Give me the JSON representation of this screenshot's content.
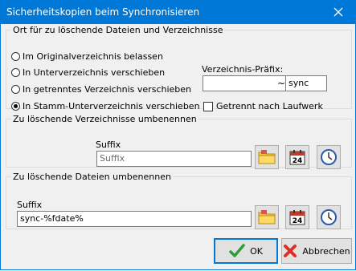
{
  "window": {
    "title": "Sicherheitskopien beim Synchronisieren"
  },
  "group_location": {
    "legend": "Ort für zu löschende Dateien und Verzeichnisse",
    "options": [
      {
        "label": "Im Originalverzeichnis belassen",
        "checked": false
      },
      {
        "label": "In Unterverzeichnis verschieben",
        "checked": false
      },
      {
        "label": "In getrenntes Verzeichnis verschieben",
        "checked": false
      },
      {
        "label": "In Stamm-Unterverzeichnis verschieben",
        "checked": true
      }
    ],
    "prefix_label": "Verzeichnis-Präfix:",
    "prefix_value": "",
    "prefix_separator": "~",
    "prefix_suffix_value": "sync",
    "separate_drive_label": "Getrennt nach Laufwerk",
    "separate_drive_checked": false
  },
  "group_dirs": {
    "legend": "Zu löschende Verzeichnisse umbenennen",
    "suffix_label": "Suffix",
    "suffix_placeholder": "Suffix",
    "suffix_value": ""
  },
  "group_files": {
    "legend": "Zu löschende Dateien umbenennen",
    "suffix_label": "Suffix",
    "suffix_value": "sync-%fdate%"
  },
  "calendar_day": "24",
  "buttons": {
    "ok": "OK",
    "cancel": "Abbrechen"
  }
}
